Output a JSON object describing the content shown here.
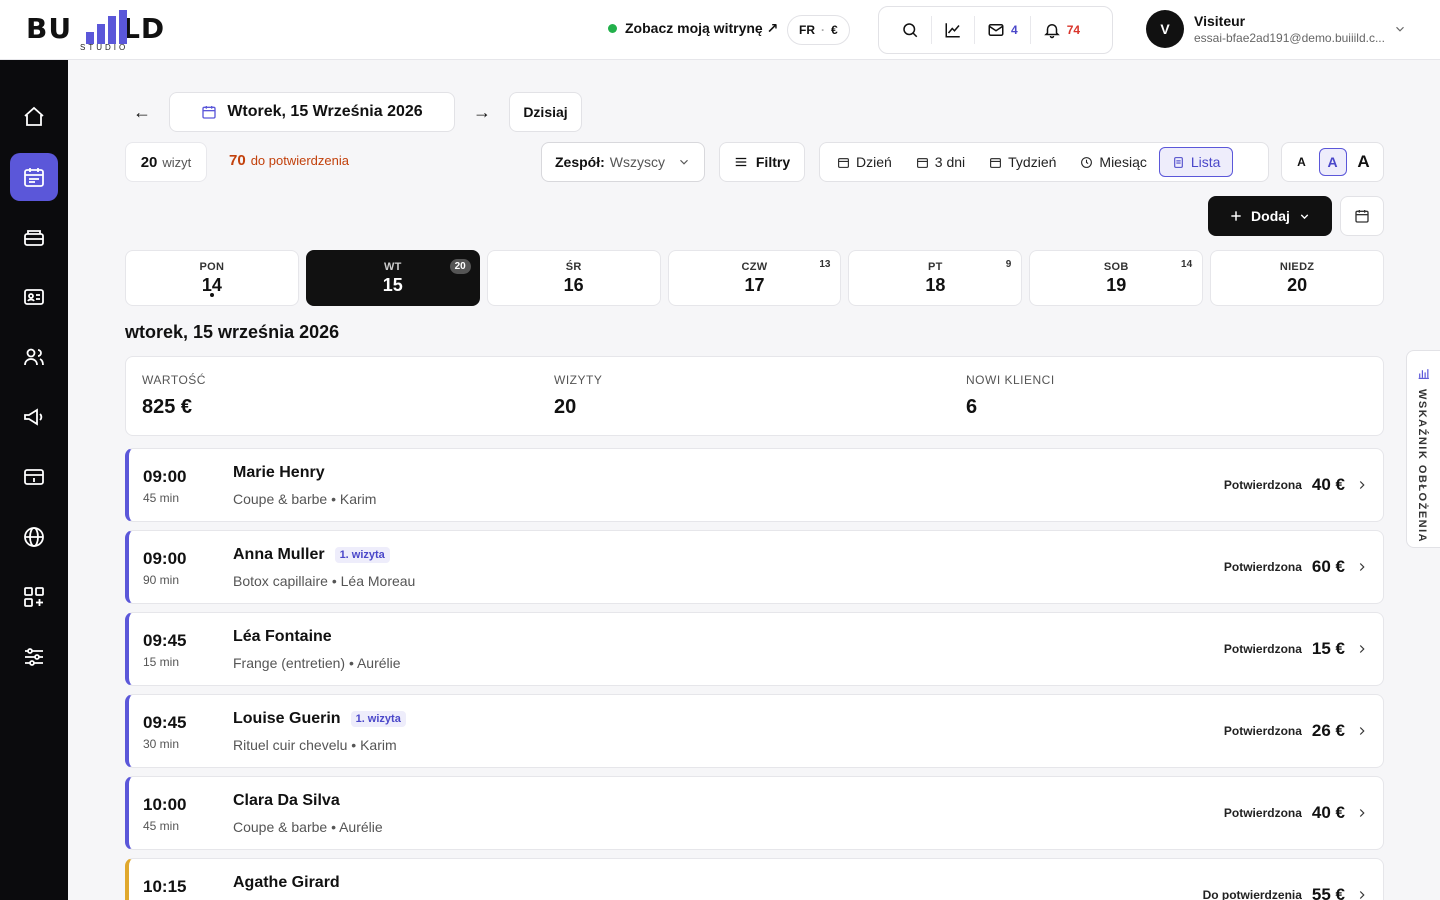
{
  "brand": {
    "logo": "BU",
    "logo_end": "LD",
    "sub": "STUDIO"
  },
  "header": {
    "site_link": "Zobacz moją witrynę ↗",
    "lang": "FR",
    "currency": "€",
    "messages_count": "4",
    "notifications_count": "74",
    "user": {
      "initial": "V",
      "name": "Visiteur",
      "email": "essai-bfae2ad191@demo.buiiild.c..."
    }
  },
  "toolbar": {
    "prev": "←",
    "next": "→",
    "date": "Wtorek, 15 Września 2026",
    "today": "Dzisiaj",
    "visits_count": "20",
    "visits_label": "wizyt",
    "pending_count": "70",
    "pending_label": "do potwierdzenia",
    "team_label": "Zespół:",
    "team_value": "Wszyscy",
    "filters": "Filtry",
    "views": [
      "Dzień",
      "3 dni",
      "Tydzień",
      "Miesiąc",
      "Lista"
    ],
    "text_sizes": [
      "A",
      "A",
      "A"
    ],
    "add": "Dodaj"
  },
  "week": [
    {
      "name": "PON",
      "num": "14",
      "badge": ""
    },
    {
      "name": "WT",
      "num": "15",
      "badge": "20"
    },
    {
      "name": "ŚR",
      "num": "16",
      "badge": ""
    },
    {
      "name": "CZW",
      "num": "17",
      "badge": "13"
    },
    {
      "name": "PT",
      "num": "18",
      "badge": "9"
    },
    {
      "name": "SOB",
      "num": "19",
      "badge": "14"
    },
    {
      "name": "NIEDZ",
      "num": "20",
      "badge": ""
    }
  ],
  "day_title": "wtorek, 15 września 2026",
  "stats": [
    {
      "label": "WARTOŚĆ",
      "value": "825 €"
    },
    {
      "label": "WIZYTY",
      "value": "20"
    },
    {
      "label": "NOWI KLIENCI",
      "value": "6"
    }
  ],
  "appointments": [
    {
      "time": "09:00",
      "duration": "45 min",
      "client": "Marie Henry",
      "badge": "",
      "service": "Coupe & barbe • Karim",
      "status": "Potwierdzona",
      "price": "40 €"
    },
    {
      "time": "09:00",
      "duration": "90 min",
      "client": "Anna Muller",
      "badge": "1. wizyta",
      "service": "Botox capillaire • Léa Moreau",
      "status": "Potwierdzona",
      "price": "60 €"
    },
    {
      "time": "09:45",
      "duration": "15 min",
      "client": "Léa Fontaine",
      "badge": "",
      "service": "Frange (entretien) • Aurélie",
      "status": "Potwierdzona",
      "price": "15 €"
    },
    {
      "time": "09:45",
      "duration": "30 min",
      "client": "Louise Guerin",
      "badge": "1. wizyta",
      "service": "Rituel cuir chevelu • Karim",
      "status": "Potwierdzona",
      "price": "26 €"
    },
    {
      "time": "10:00",
      "duration": "45 min",
      "client": "Clara Da Silva",
      "badge": "",
      "service": "Coupe & barbe • Aurélie",
      "status": "Potwierdzona",
      "price": "40 €"
    },
    {
      "time": "10:15",
      "duration": "",
      "client": "Agathe Girard",
      "badge": "",
      "service": "",
      "status": "Do potwierdzenia",
      "price": "55 €"
    }
  ],
  "side_tab": "WSKAŹNIK OBŁOŻENIA",
  "colors": {
    "accent": "#5b57d9",
    "pending": "#e0a82e",
    "sidebar": "#0b0b0d"
  }
}
